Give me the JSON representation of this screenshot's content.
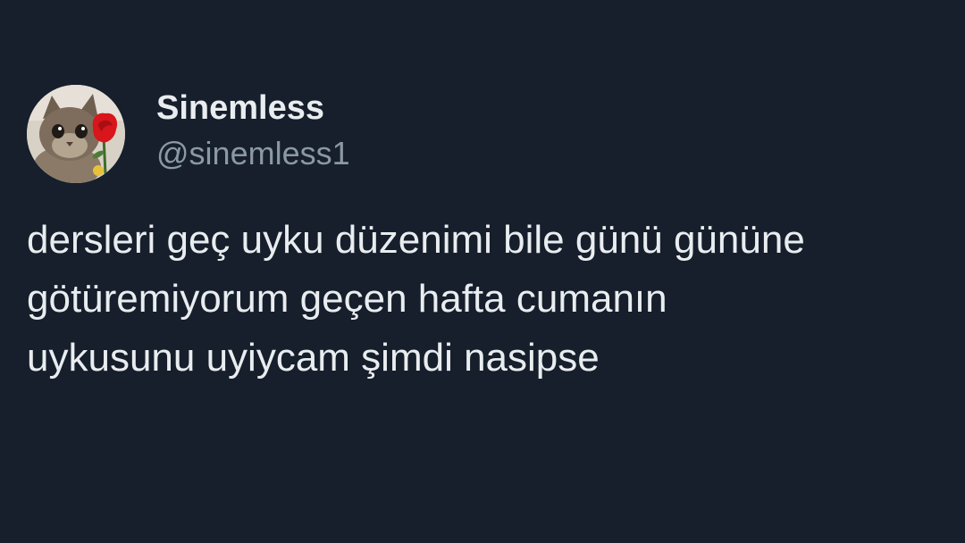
{
  "tweet": {
    "display_name": "Sinemless",
    "handle": "@sinemless1",
    "text": "dersleri geç uyku düzenimi bile günü gününe\ngötüremiyorum geçen hafta cumanın\nuykusunu uyiycam şimdi nasipse",
    "avatar_icon": "kitten-with-red-rose-avatar"
  },
  "colors": {
    "background": "#161f2b",
    "primary_text": "#e9edf0",
    "secondary_text": "#8b98a5"
  }
}
